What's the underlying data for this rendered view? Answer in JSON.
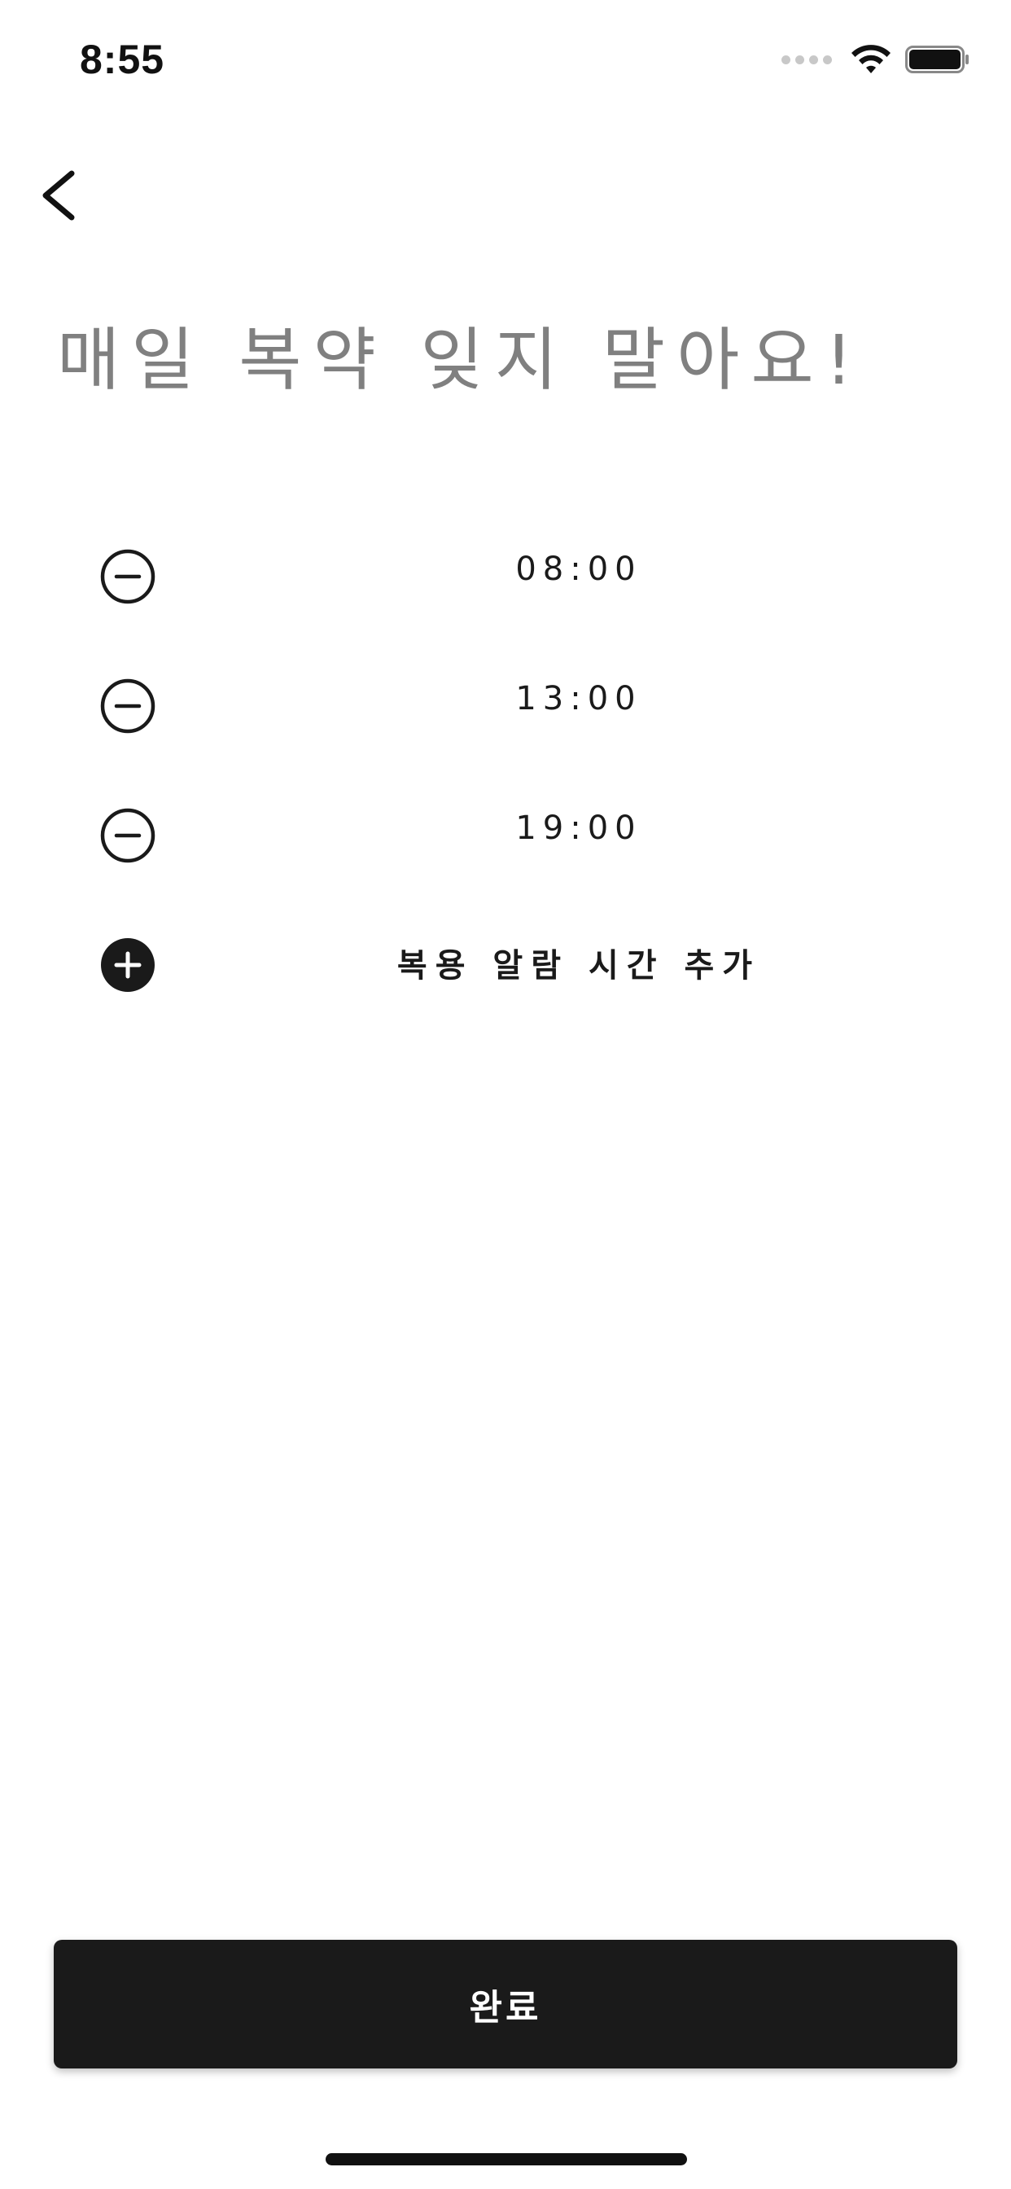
{
  "status_bar": {
    "time": "8:55"
  },
  "nav": {
    "back_icon": "chevron-left-icon"
  },
  "title": "매일 복약 잊지 말아요!",
  "alarms": [
    {
      "time": "08:00",
      "icon": "minus-circle-icon"
    },
    {
      "time": "13:00",
      "icon": "minus-circle-icon"
    },
    {
      "time": "19:00",
      "icon": "minus-circle-icon"
    }
  ],
  "add_alarm": {
    "label": "복용 알람 시간 추가",
    "icon": "plus-circle-filled-icon"
  },
  "done_button": {
    "label": "완료"
  },
  "colors": {
    "title": "#808080",
    "text": "#1a1a1a",
    "button_bg": "#1a1a1a",
    "button_text": "#ffffff",
    "background": "#ffffff"
  }
}
